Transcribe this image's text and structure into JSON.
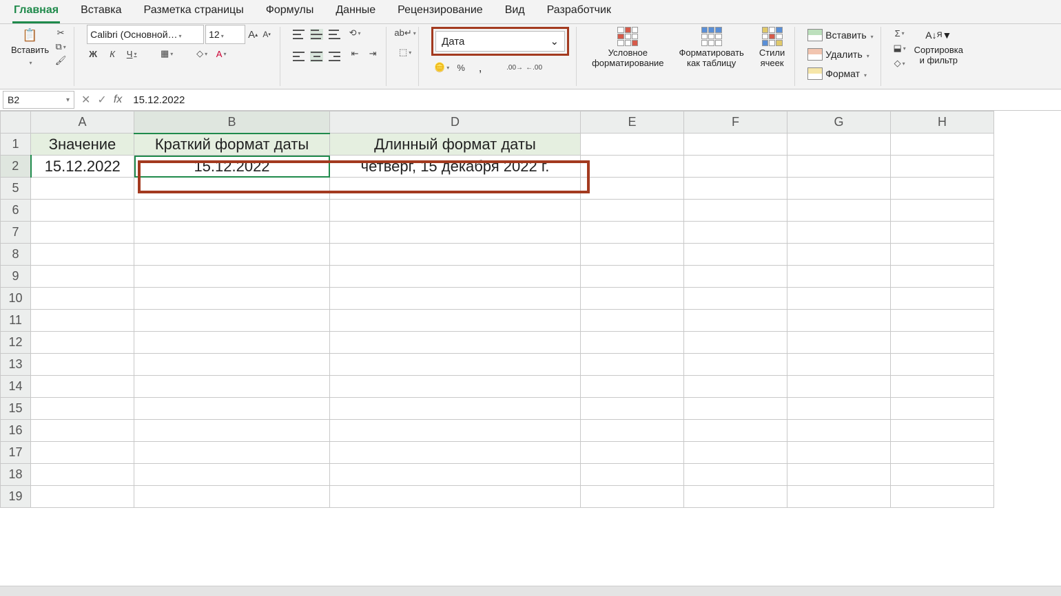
{
  "tabs": [
    "Главная",
    "Вставка",
    "Разметка страницы",
    "Формулы",
    "Данные",
    "Рецензирование",
    "Вид",
    "Разработчик"
  ],
  "active_tab": 0,
  "ribbon": {
    "paste_label": "Вставить",
    "font_name": "Calibri (Основной…",
    "font_size": "12",
    "number_format": "Дата",
    "cond_format": "Условное\nформатирование",
    "format_table": "Форматировать\nкак таблицу",
    "cell_styles": "Стили\nячеек",
    "insert": "Вставить",
    "delete": "Удалить",
    "format": "Формат",
    "sort_filter": "Сортировка\nи фильтр"
  },
  "namebox": "B2",
  "formula": "15.12.2022",
  "columns": [
    "A",
    "B",
    "D",
    "E",
    "F",
    "G",
    "H"
  ],
  "rows": [
    "1",
    "2",
    "5",
    "6",
    "7",
    "8",
    "9",
    "10",
    "11",
    "12",
    "13",
    "14",
    "15",
    "16",
    "17",
    "18",
    "19"
  ],
  "cells": {
    "A1": "Значение",
    "B1": "Краткий формат даты",
    "D1": "Длинный формат даты",
    "A2": "15.12.2022",
    "B2": "15.12.2022",
    "D2": "четверг, 15 декабря 2022 г."
  },
  "selected_cell": "B2"
}
